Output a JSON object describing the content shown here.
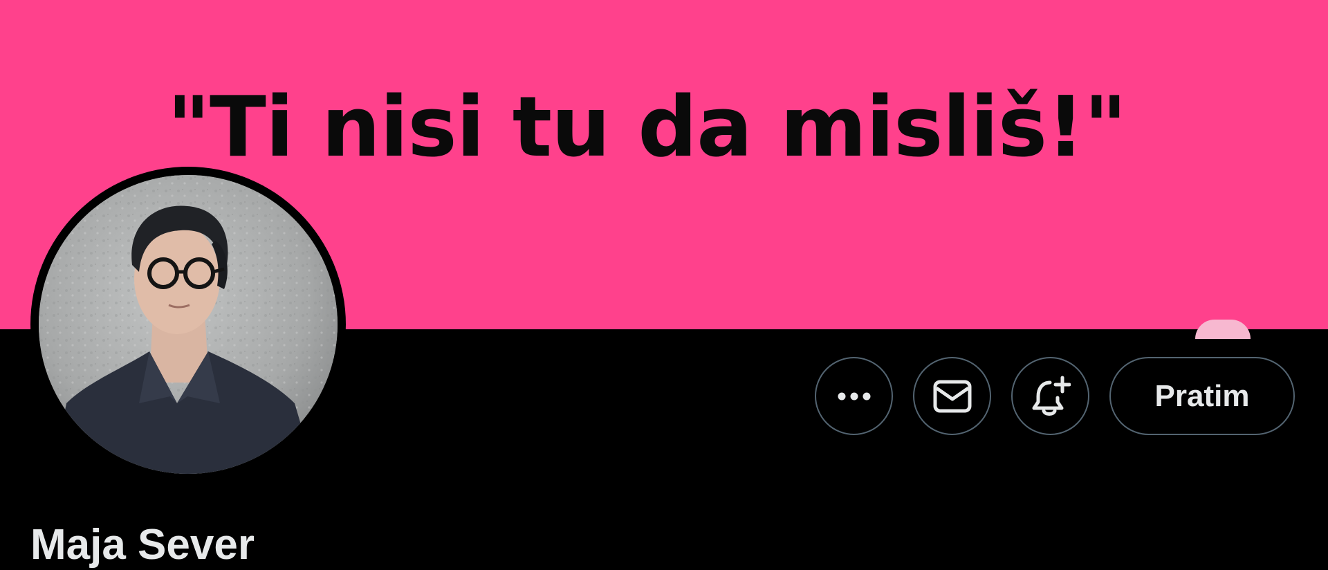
{
  "banner": {
    "text": "\"Ti nisi tu da misliš!\"",
    "background_color": "#ff418c"
  },
  "profile": {
    "display_name": "Maja Sever",
    "avatar_icon": "profile-photo"
  },
  "actions": {
    "more_icon": "more-horizontal-icon",
    "message_icon": "envelope-icon",
    "notify_icon": "bell-plus-icon",
    "follow_label": "Pratim"
  },
  "colors": {
    "background": "#000000",
    "text": "#e7e9ea",
    "button_border": "#536471"
  }
}
